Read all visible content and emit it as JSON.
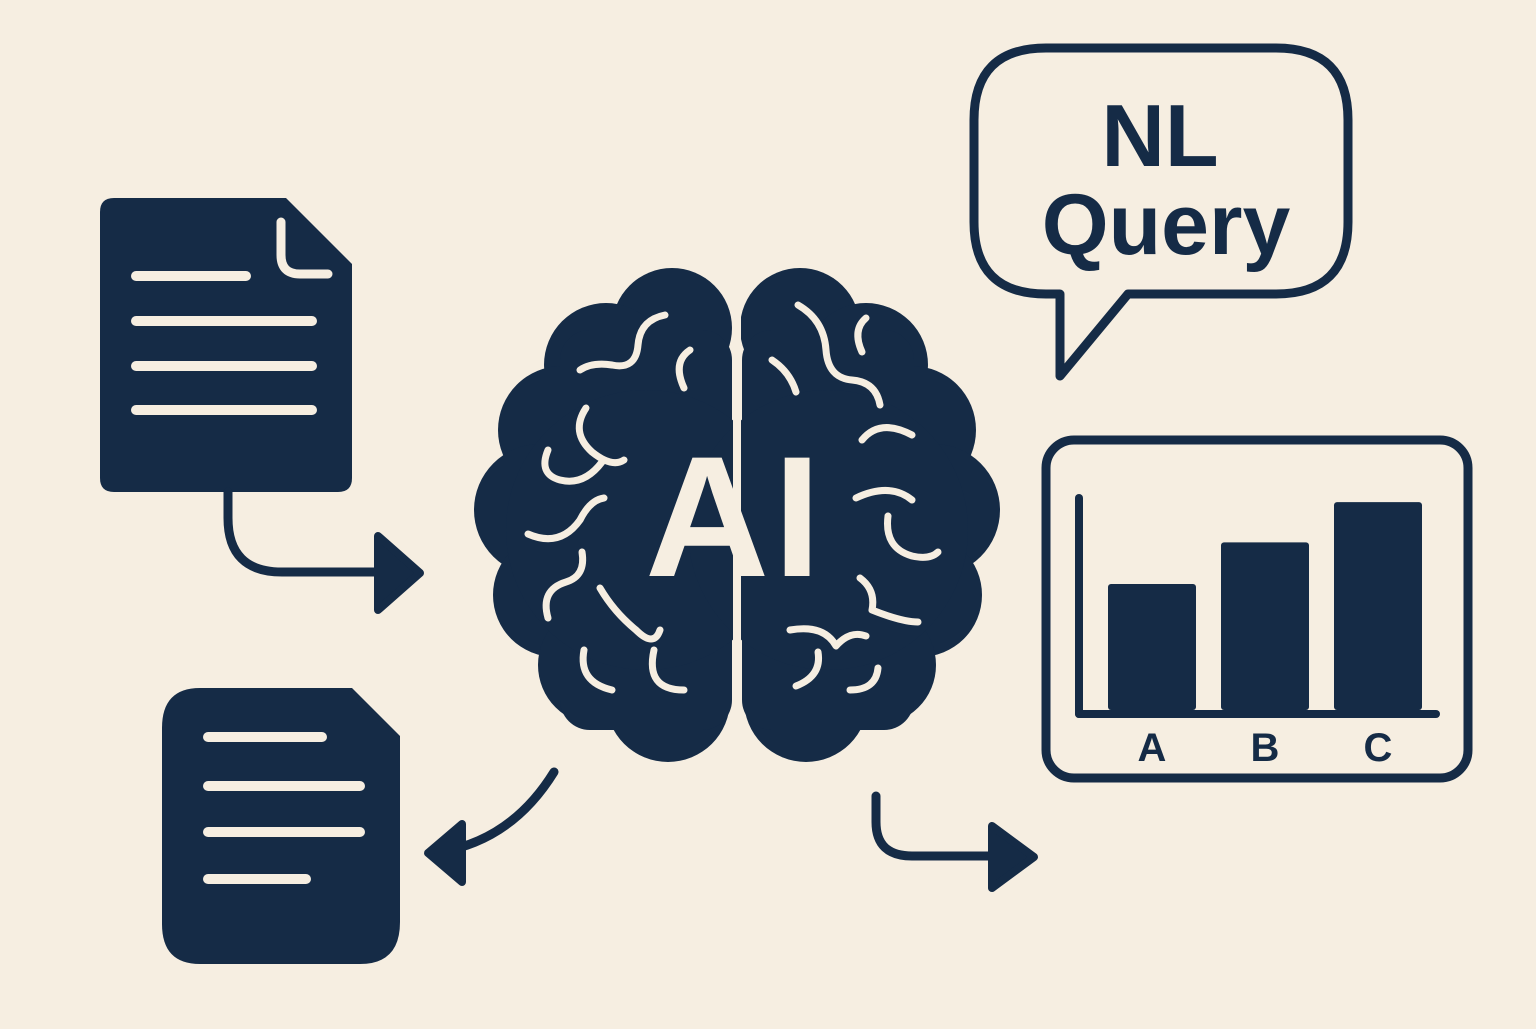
{
  "colors": {
    "background": "#F6EEE1",
    "ink": "#152B46",
    "paper": "#F6EEE1"
  },
  "brain": {
    "label": "AI",
    "icon": "brain-icon"
  },
  "speech_bubble": {
    "line1": "NL",
    "line2": "Query",
    "icon": "speech-bubble-icon"
  },
  "input_document": {
    "icon": "document-icon"
  },
  "output_document": {
    "icon": "document-icon"
  },
  "chart_data": {
    "type": "bar",
    "categories": [
      "A",
      "B",
      "C"
    ],
    "values": [
      1.0,
      1.33,
      1.65
    ],
    "title": "",
    "xlabel": "",
    "ylabel": "",
    "grid": false
  },
  "arrows": [
    {
      "name": "document-to-ai",
      "icon": "curved-arrow-icon"
    },
    {
      "name": "ai-to-document",
      "icon": "curved-arrow-icon"
    },
    {
      "name": "ai-to-chart",
      "icon": "curved-arrow-icon"
    }
  ]
}
